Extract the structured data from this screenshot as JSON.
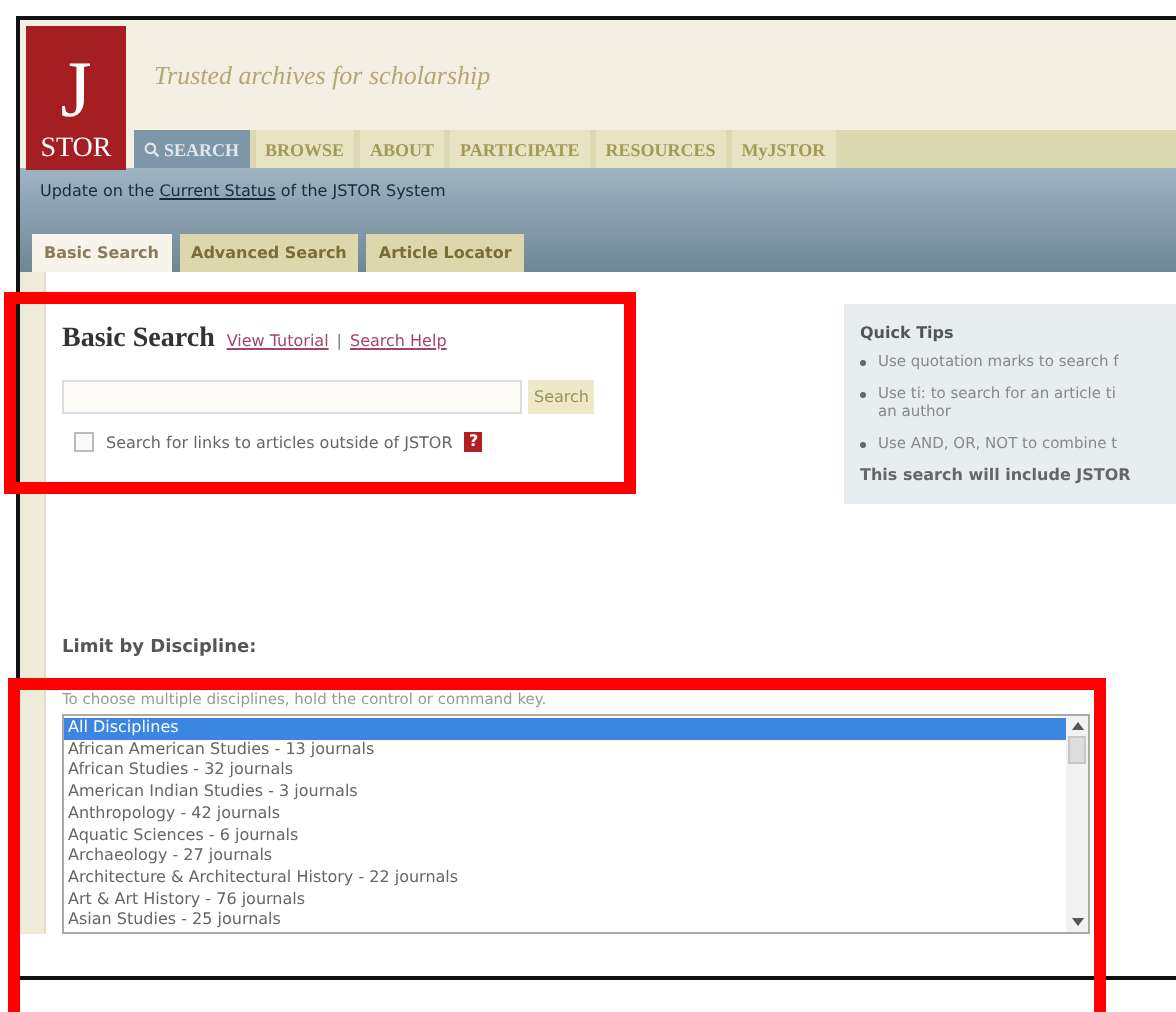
{
  "logo": {
    "letter": "J",
    "word": "STOR"
  },
  "tagline": "Trusted archives for scholarship",
  "nav": [
    {
      "label": "SEARCH",
      "selected": true
    },
    {
      "label": "BROWSE",
      "selected": false
    },
    {
      "label": "ABOUT",
      "selected": false
    },
    {
      "label": "PARTICIPATE",
      "selected": false
    },
    {
      "label": "RESOURCES",
      "selected": false
    },
    {
      "label": "MyJSTOR",
      "selected": false
    }
  ],
  "status": {
    "before": "Update on the",
    "link": "Current Status",
    "after": "of the JSTOR System"
  },
  "tabs": [
    {
      "label": "Basic Search",
      "selected": true
    },
    {
      "label": "Advanced Search",
      "selected": false
    },
    {
      "label": "Article Locator",
      "selected": false
    }
  ],
  "search": {
    "title": "Basic Search",
    "links": [
      "View Tutorial",
      "Search Help"
    ],
    "separator": "|",
    "button": "Search",
    "checkbox": {
      "label": "Search for links to articles outside of JSTOR",
      "checked": false
    },
    "help": "?"
  },
  "tips": {
    "title": "Quick Tips",
    "items": [
      "Use quotation marks to search f",
      "Use ti: to search for an article ti\nan author",
      "Use AND, OR, NOT to combine t"
    ],
    "footer": "This search will include JSTOR"
  },
  "discipline": {
    "label": "Limit by Discipline:",
    "hint": "To choose multiple disciplines, hold the control or command key.",
    "options": [
      {
        "label": "All Disciplines",
        "selected": true
      },
      {
        "label": "African American Studies - 13 journals",
        "selected": false
      },
      {
        "label": "African Studies - 32 journals",
        "selected": false
      },
      {
        "label": "American Indian Studies - 3 journals",
        "selected": false
      },
      {
        "label": "Anthropology - 42 journals",
        "selected": false
      },
      {
        "label": "Aquatic Sciences - 6 journals",
        "selected": false
      },
      {
        "label": "Archaeology - 27 journals",
        "selected": false
      },
      {
        "label": "Architecture & Architectural History - 22 journals",
        "selected": false
      },
      {
        "label": "Art & Art History - 76 journals",
        "selected": false
      },
      {
        "label": "Asian Studies - 25 journals",
        "selected": false
      }
    ]
  }
}
